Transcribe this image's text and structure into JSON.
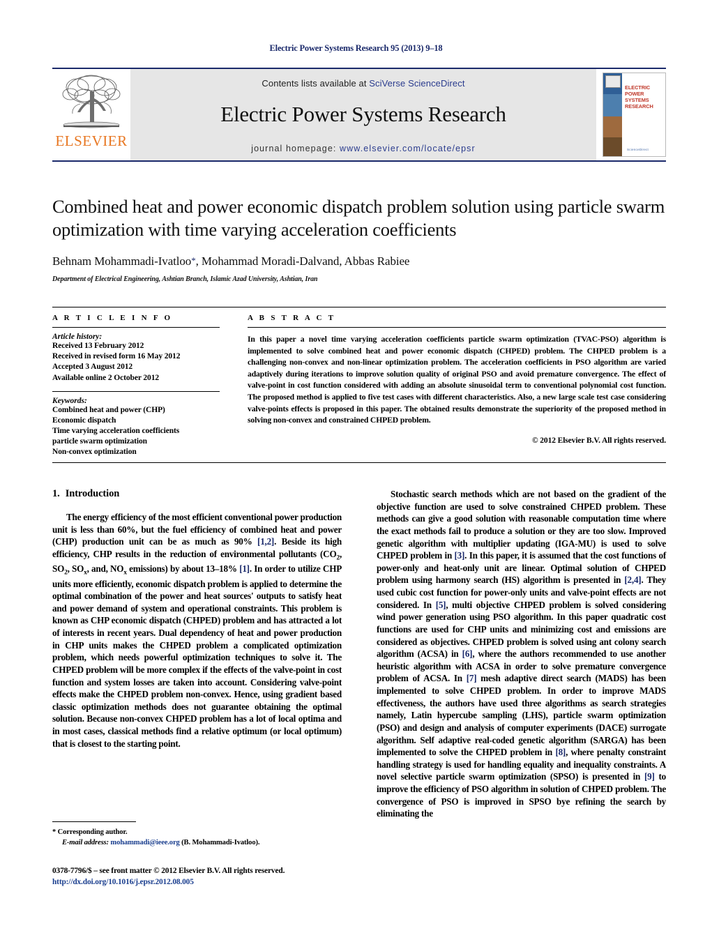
{
  "running_head": "Electric Power Systems Research 95 (2013) 9–18",
  "masthead": {
    "publisher_logo_text": "ELSEVIER",
    "contents_prefix": "Contents lists available at ",
    "contents_link": "SciVerse ScienceDirect",
    "journal_title": "Electric Power Systems Research",
    "homepage_label": "journal homepage: ",
    "homepage_url": "www.elsevier.com/locate/epsr",
    "cover": {
      "title": "ELECTRIC POWER SYSTEMS RESEARCH",
      "footer": "ScienceDirect"
    }
  },
  "article": {
    "title": "Combined heat and power economic dispatch problem solution using particle swarm optimization with time varying acceleration coefficients",
    "authors": "Behnam Mohammadi-Ivatloo",
    "authors_rest": ", Mohammad Moradi-Dalvand, Abbas Rabiee",
    "corresponding_marker": "*",
    "affiliation": "Department of Electrical Engineering, Ashtian Branch, Islamic Azad University, Ashtian, Iran"
  },
  "article_info": {
    "heading": "A R T I C L E   I N F O",
    "history_label": "Article history:",
    "history": [
      "Received 13 February 2012",
      "Received in revised form 16 May 2012",
      "Accepted 3 August 2012",
      "Available online 2 October 2012"
    ],
    "keywords_label": "Keywords:",
    "keywords": [
      "Combined heat and power (CHP)",
      "Economic dispatch",
      "Time varying acceleration coefficients",
      "particle swarm optimization",
      "Non-convex optimization"
    ]
  },
  "abstract": {
    "heading": "A B S T R A C T",
    "text": "In this paper a novel time varying acceleration coefficients particle swarm optimization (TVAC-PSO) algorithm is implemented to solve combined heat and power economic dispatch (CHPED) problem. The CHPED problem is a challenging non-convex and non-linear optimization problem. The acceleration coefficients in PSO algorithm are varied adaptively during iterations to improve solution quality of original PSO and avoid premature convergence. The effect of valve-point in cost function considered with adding an absolute sinusoidal term to conventional polynomial cost function. The proposed method is applied to five test cases with different characteristics. Also, a new large scale test case considering valve-points effects is proposed in this paper. The obtained results demonstrate the superiority of the proposed method in solving non-convex and constrained CHPED problem.",
    "copyright": "© 2012 Elsevier B.V. All rights reserved."
  },
  "introduction": {
    "number": "1.",
    "heading": "Introduction",
    "left_paragraph_part1": "The energy efficiency of the most efficient conventional power production unit is less than 60%, but the fuel efficiency of combined heat and power (CHP) production unit can be as much as 90% ",
    "ref_1_2": "[1,2]",
    "left_paragraph_part2": ". Beside its high efficiency, CHP results in the reduction of environmental pollutants (CO",
    "sub_2a": "2",
    "left_paragraph_part3": ", SO",
    "sub_2b": "2",
    "left_paragraph_part4": ", SO",
    "sub_xa": "x",
    "left_paragraph_part5": ", and, NO",
    "sub_xb": "x",
    "left_paragraph_part6": " emissions) by about 13–18% ",
    "ref_1": "[1]",
    "left_paragraph_part7": ". In order to utilize CHP units more efficiently, economic dispatch problem is applied to determine the optimal combination of the power and heat sources' outputs to satisfy heat and power demand of system and operational constraints. This problem is known as CHP economic dispatch (CHPED) problem and has attracted a lot of interests in recent years. Dual dependency of heat and power production in CHP units makes the CHPED problem a complicated optimization problem, which needs powerful optimization techniques to solve it. The CHPED problem will be more complex if the effects of the valve-point in cost function and system losses are taken into account. Considering valve-point effects make the CHPED problem non-convex. Hence, using gradient based classic optimization methods does not guarantee obtaining the optimal solution. Because non-convex CHPED problem has a lot of local optima and in most cases, classical methods find a relative optimum (or local optimum) that is closest to the starting point.",
    "right_part1": "Stochastic search methods which are not based on the gradient of the objective function are used to solve constrained CHPED problem. These methods can give a good solution with reasonable computation time where the exact methods fail to produce a solution or they are too slow. Improved genetic algorithm with multiplier updating (IGA-MU) is used to solve CHPED problem in ",
    "ref_3": "[3]",
    "right_part2": ". In this paper, it is assumed that the cost functions of power-only and heat-only unit are linear. Optimal solution of CHPED problem using harmony search (HS) algorithm is presented in ",
    "ref_2_4": "[2,4]",
    "right_part3": ". They used cubic cost function for power-only units and valve-point effects are not considered. In ",
    "ref_5": "[5]",
    "right_part4": ", multi objective CHPED problem is solved considering wind power generation using PSO algorithm. In this paper quadratic cost functions are used for CHP units and minimizing cost and emissions are considered as objectives. CHPED problem is solved using ant colony search algorithm (ACSA) in ",
    "ref_6": "[6]",
    "right_part5": ", where the authors recommended to use another heuristic algorithm with ACSA in order to solve premature convergence problem of ACSA. In ",
    "ref_7": "[7]",
    "right_part6": " mesh adaptive direct search (MADS) has been implemented to solve CHPED problem. In order to improve MADS effectiveness, the authors have used three algorithms as search strategies namely, Latin hypercube sampling (LHS), particle swarm optimization (PSO) and design and analysis of computer experiments (DACE) surrogate algorithm. Self adaptive real-coded genetic algorithm (SARGA) has been implemented to solve the CHPED problem in ",
    "ref_8": "[8]",
    "right_part7": ", where penalty constraint handling strategy is used for handling equality and inequality constraints. A novel selective particle swarm optimization (SPSO) is presented in ",
    "ref_9": "[9]",
    "right_part8": " to improve the efficiency of PSO algorithm in solution of CHPED problem. The convergence of PSO is improved in SPSO bye refining the search by eliminating the"
  },
  "footnote": {
    "corresponding": "* Corresponding author.",
    "email_label": "E-mail address:",
    "email": "mohammadi@ieee.org",
    "email_suffix": " (B. Mohammadi-Ivatloo)."
  },
  "footer": {
    "issn_line": "0378-7796/$ – see front matter © 2012 Elsevier B.V. All rights reserved.",
    "doi": "http://dx.doi.org/10.1016/j.epsr.2012.08.005"
  },
  "colors": {
    "navy": "#1b2a6b",
    "link": "#2b3c8e",
    "elsevier_orange": "#E87722",
    "band_gray": "#e6e6e6"
  }
}
